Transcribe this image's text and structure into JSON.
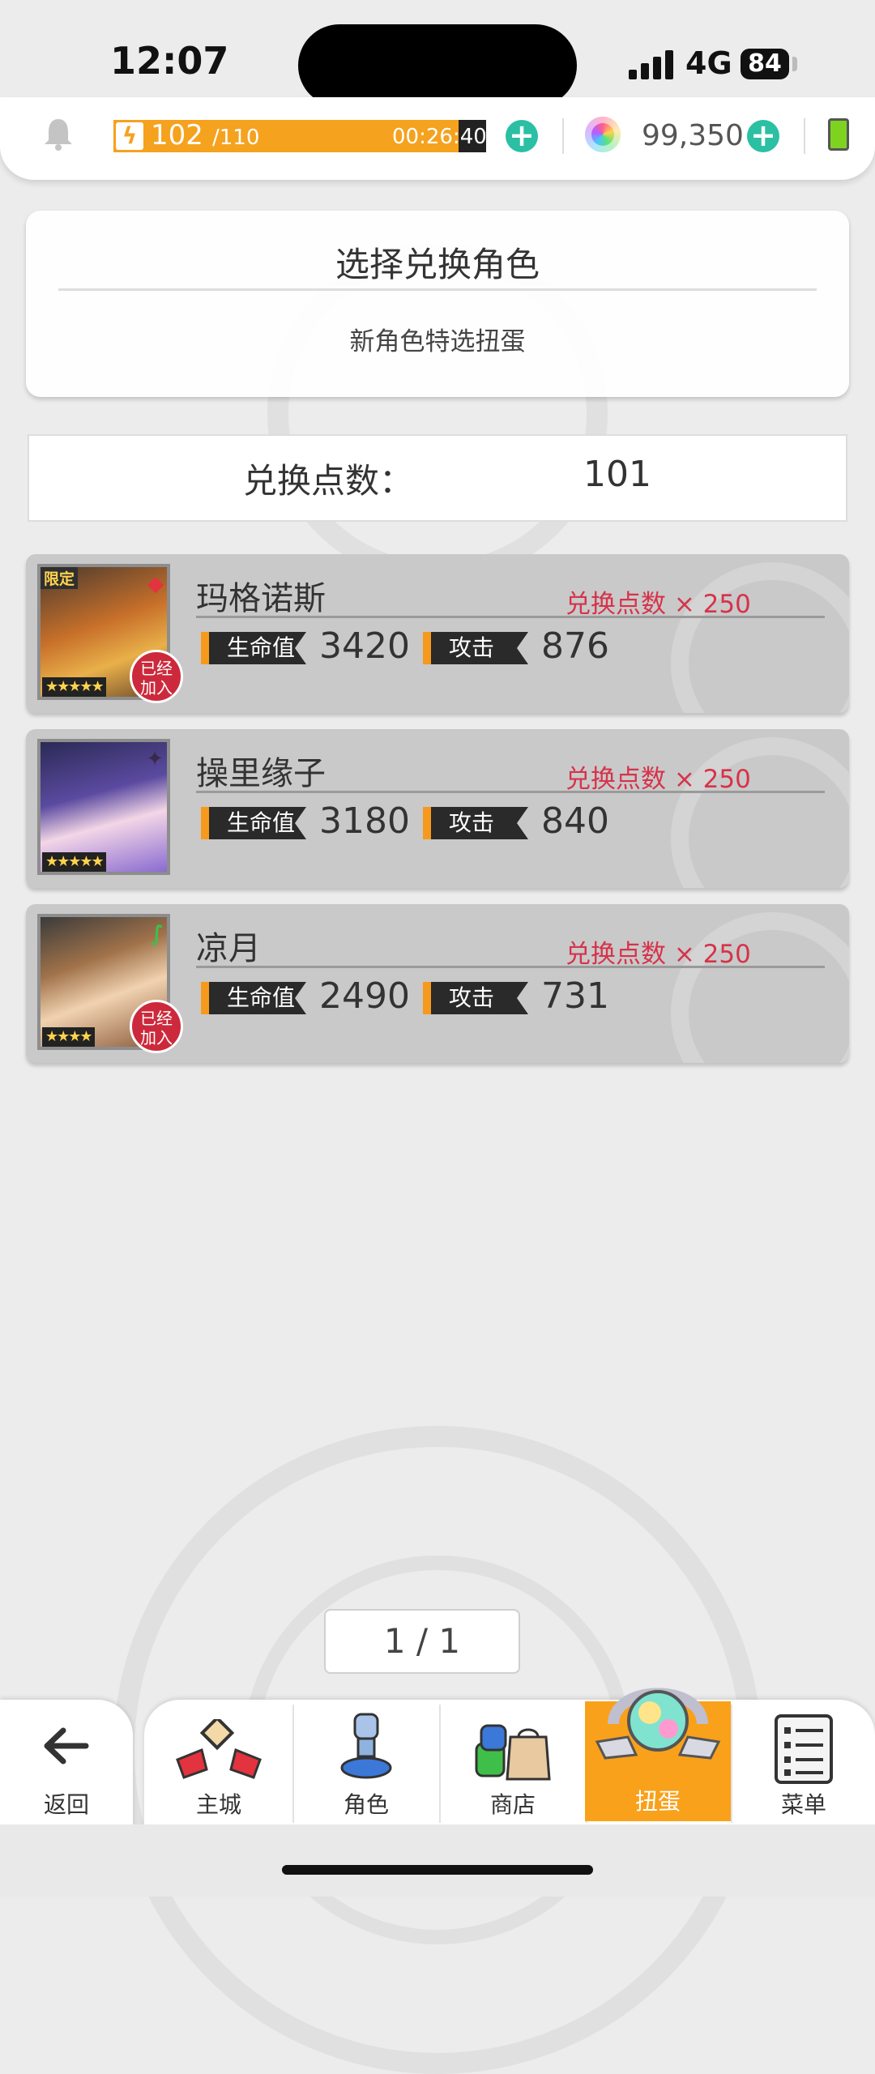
{
  "status_bar": {
    "time": "12:07",
    "network": "4G",
    "battery": "84"
  },
  "resources": {
    "stamina_current": "102",
    "stamina_max": "/110",
    "stamina_timer": "00:26:40",
    "stamina_level": 0.927,
    "gems": "99,350"
  },
  "header": {
    "title": "选择兑换角色",
    "subtitle": "新角色特选扭蛋"
  },
  "points": {
    "label": "兑换点数：",
    "value": "101"
  },
  "stat_labels": {
    "hp": "生命值",
    "attack": "攻击"
  },
  "characters": [
    {
      "name": "玛格诺斯",
      "cost": "兑换点数 × 250",
      "hp": "3420",
      "attack": "876",
      "stars": "★★★★★",
      "limited": "限定",
      "joined": "已经\n加入",
      "element_icon": "diamond-suit-icon"
    },
    {
      "name": "操里缘子",
      "cost": "兑换点数 × 250",
      "hp": "3180",
      "attack": "840",
      "stars": "★★★★★",
      "element_icon": "four-point-star-icon"
    },
    {
      "name": "凉月",
      "cost": "兑换点数 × 250",
      "hp": "2490",
      "attack": "731",
      "stars": "★★★★",
      "joined": "已经\n加入",
      "element_icon": "leaf-icon"
    }
  ],
  "pager": {
    "text": "1 / 1"
  },
  "nav": {
    "back": "返回",
    "items": [
      "主城",
      "角色",
      "商店",
      "扭蛋",
      "菜单"
    ],
    "active_index": 3
  },
  "colors": {
    "accent_orange": "#f9a11b",
    "cost_red": "#d6334a",
    "plus_teal": "#2bbfa4",
    "joined_badge": "#cc2a3c"
  }
}
